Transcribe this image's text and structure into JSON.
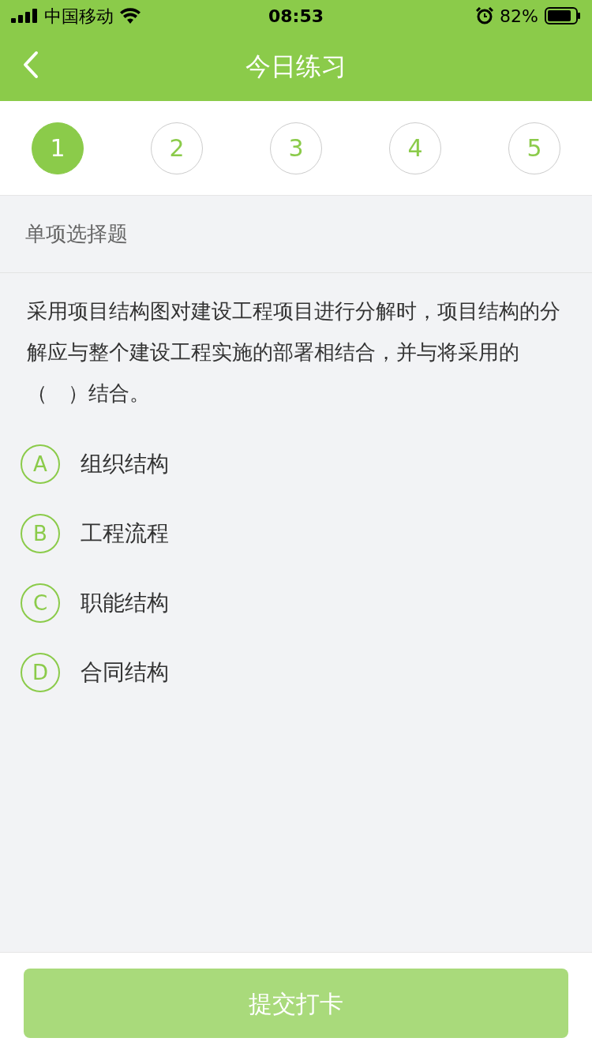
{
  "status_bar": {
    "carrier": "中国移动",
    "time": "08:53",
    "battery": "82%"
  },
  "nav": {
    "title": "今日练习"
  },
  "steps": [
    {
      "label": "1",
      "selected": true
    },
    {
      "label": "2",
      "selected": false
    },
    {
      "label": "3",
      "selected": false
    },
    {
      "label": "4",
      "selected": false
    },
    {
      "label": "5",
      "selected": false
    }
  ],
  "question": {
    "type_label": "单项选择题",
    "text": "采用项目结构图对建设工程项目进行分解时，项目结构的分解应与整个建设工程实施的部署相结合，并与将采用的（　）结合。",
    "options": [
      {
        "letter": "A",
        "text": "组织结构",
        "selected": false
      },
      {
        "letter": "B",
        "text": "工程流程",
        "selected": false
      },
      {
        "letter": "C",
        "text": "职能结构",
        "selected": false
      },
      {
        "letter": "D",
        "text": "合同结构",
        "selected": false
      }
    ]
  },
  "submit": {
    "label": "提交打卡",
    "disabled": true
  }
}
